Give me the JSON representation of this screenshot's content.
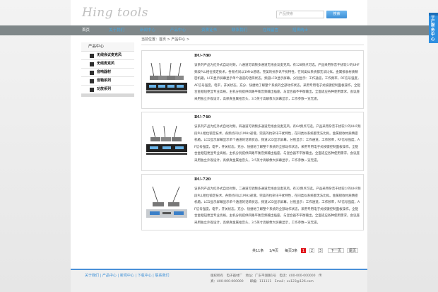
{
  "logo": "Hing tools",
  "search": {
    "placeholder": "产品搜索",
    "button": "搜索"
  },
  "nav": [
    "首页",
    "关于我们",
    "新闻中心",
    "产品中心",
    "资质证书",
    "联系我们",
    "在线留言",
    "招贤纳士"
  ],
  "breadcrumb": "当前位置：首页 > 产品中心 >",
  "sidebar": {
    "title": "产品中心",
    "items": [
      "无线会议麦克风",
      "无线麦克风",
      "音响器材",
      "音箱系列",
      "功放系列"
    ]
  },
  "products": [
    {
      "title": "DU-780",
      "desc": "该系列产品为红外式自动对频，八通道可调频多通道无线会议麦克风，有128频点可选。产品采用杂音干扰较少的UHF频段PLL相位锁定技术，各频点间以1MHz递增。完美的抗杂讯干扰特性，在同类似系统都无法比拟。金属接收材质精密机箱，LCD显示屏幕显示单个通道的话筒状态，频道LCD显示屏幕，分别显示：工作通道，工作频率，RF信号强度，AF信号强度，电平，开关状态。充分、快捷地了解整个系统的全部动作状态，采用专用电子式按键控制面板操作。全铝合金咽钮更显专业高格。主机分别提供四路平衡音频输出插座，与混合器不平衡输出，全面适应各种使用需求。会议座采用独立外观设计，高保真金属拾音头，3.5英寸高解像大屏幕显示，工作参数一览无遗。"
    },
    {
      "title": "DU-740",
      "desc": "该系列产品为红外式自动对频，四通道可调频多通道无线会议麦克风，有64频点可选。产品采用杂音干扰较少的UHF频段PLL相位锁定技术，各频点间以1MHz递增。完美的抗杂讯干扰特性，在同类似系统都无法比拟。金属接收材质精密机箱，LCD显示屏幕显示单个通道的话筒状态，频道LCD显示屏幕，分别显示：工作通道，工作频率，RF信号强度，AF信号强度，电平，开关状态。充分、快捷地了解整个系统的全部动作状态，采用专用电子式按键控制面板操作。全铝合金咽钮更显专业高格。主机分别提供四路平衡音频输出插座，与混合器不平衡输出，全面适应各种使用需求。会议座采用独立外观设计，高保真金属拾音头，3.5英寸高解像大屏幕显示，工作参数一览无遗。"
    },
    {
      "title": "DU-720",
      "desc": "该系列产品为红外式自动对频，二通道可调频多通道无线会议麦克风，有32频点可选。产品采用杂音干扰较少的UHF频段PLL相位锁定技术，各频点间以1MHz递增。完美的抗杂讯干扰特性，在同类似系统都无法比拟。金属接收材质精密机箱，LCD显示屏幕显示单个通道的话筒状态，频道LCD显示屏幕，分别显示：工作通道，工作频率，RF信号强度，AF信号强度，电平，开关状态。充分、快捷地了解整个系统的全部动作状态，采用专用电子式按键控制面板操作。全铝合金咽钮更显专业高格。主机分别提供四路平衡音频输出插座，与混合器不平衡输出，全面适应各种使用需求。会议座采用独立外观设计，高保真金属拾音头，3.5英寸高解像大屏幕显示，工作参数一览无遗。"
    }
  ],
  "pager": {
    "total": "共11条",
    "page": "1/4页",
    "per": "每页3条",
    "pages": [
      "1",
      "2",
      "3"
    ],
    "next": "下一页",
    "last": "尾页"
  },
  "footer": {
    "links": "关于我们 | 产品中心 | 新闻中心 | 下载中心 | 联系我们",
    "line1": "版权所有　电子器材厂　地址：广东平湖路1号　电话：400-000-000000　传",
    "line2": "真：400-000-000000　　邮编：111111　Email：xx123@126.com"
  },
  "service": "客户服务中心"
}
